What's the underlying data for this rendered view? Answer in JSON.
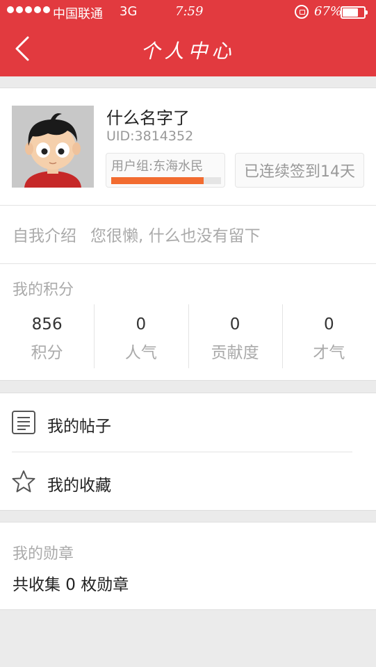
{
  "status_bar": {
    "carrier": "中国联通",
    "network": "3G",
    "time": "7:59",
    "battery": "67%"
  },
  "header": {
    "title": "个人中心",
    "background_color": "#e23a3f"
  },
  "profile": {
    "username": "什么名字了",
    "uid": "UID:3814352",
    "user_group": "用户组:东海水民",
    "level_progress": 0.84,
    "progress_color": "#f26c30",
    "signin": "已连续签到14天",
    "intro_label": "自我介绍",
    "intro_text": "您很懒, 什么也没有留下"
  },
  "points": {
    "title": "我的积分",
    "stats": [
      {
        "value": "856",
        "label": "积分"
      },
      {
        "value": "0",
        "label": "人气"
      },
      {
        "value": "0",
        "label": "贡献度"
      },
      {
        "value": "0",
        "label": "才气"
      }
    ]
  },
  "menu": {
    "items": [
      {
        "label": "我的帖子",
        "icon": "document-icon"
      },
      {
        "label": "我的收藏",
        "icon": "star-icon"
      }
    ]
  },
  "medals": {
    "title": "我的勋章",
    "summary": "共收集 0 枚勋章"
  }
}
